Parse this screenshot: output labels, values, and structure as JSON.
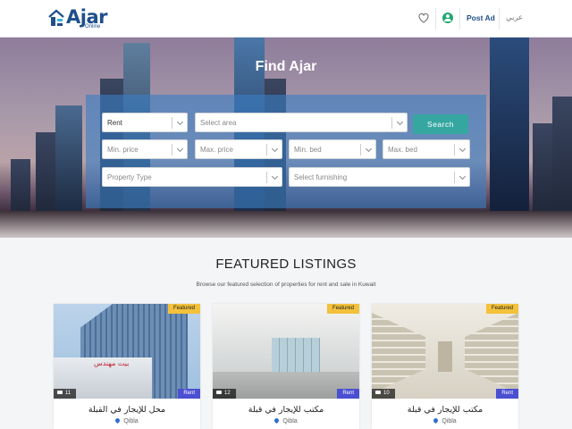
{
  "header": {
    "logo_text": "Ajar",
    "logo_sub": "Online",
    "post_ad_label": "Post Ad",
    "language_label": "عربي",
    "icons": [
      "heart-icon",
      "user-icon"
    ]
  },
  "hero": {
    "title": "Find Ajar",
    "search": {
      "purpose": "Rent",
      "area_placeholder": "Select area",
      "search_label": "Search",
      "min_price_placeholder": "Min. price",
      "max_price_placeholder": "Max. price",
      "min_bed_placeholder": "Min. bed",
      "max_bed_placeholder": "Max. bed",
      "property_type_placeholder": "Property Type",
      "furnishing_placeholder": "Select furnishing"
    }
  },
  "featured": {
    "title": "FEATURED LISTINGS",
    "subtitle": "Browse our featured selection of properties for rent and sale in Kuwait",
    "listings": [
      {
        "badge": "Featured",
        "type": "Rent",
        "photos": "11",
        "title": "محل للإيجار في القبلة",
        "location": "Qibla",
        "sign_text": "بيت مهندس"
      },
      {
        "badge": "Featured",
        "type": "Rent",
        "photos": "12",
        "title": "مكتب للإيجار في قبلة",
        "location": "Qibla"
      },
      {
        "badge": "Featured",
        "type": "Rent",
        "photos": "10",
        "title": "مكتب للإيجار في قبلة",
        "location": "Qibla"
      }
    ]
  },
  "colors": {
    "brand": "#1f4f8c",
    "search_button": "#36a6a1",
    "featured_badge": "#f3c13a",
    "rent_badge": "#4b4fd1",
    "user_icon": "#1ea86f"
  }
}
